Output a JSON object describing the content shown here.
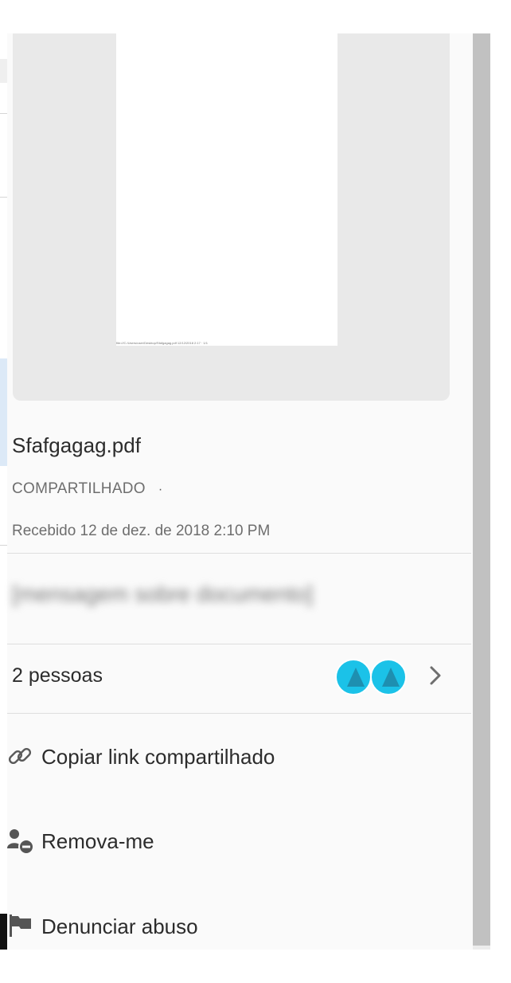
{
  "file": {
    "name": "Sfafgagag.pdf",
    "share_status": "COMPARTILHADO",
    "status_separator": "·",
    "received": "Recebido 12 de dez. de 2018 2:10 PM",
    "preview_footer": "file:///C:/Users/user/Desktop/Sfafgagag.pdf  12/12/2018  2:17 · 1/1"
  },
  "message": {
    "text": "[mensagem sobre documento]"
  },
  "people": {
    "label": "2 pessoas",
    "avatar_color": "#1bc2e8"
  },
  "actions": {
    "copy_link": "Copiar link compartilhado",
    "remove_me": "Remova-me",
    "report_abuse": "Denunciar abuso"
  },
  "icons": {
    "chevron": "chevron-right-icon",
    "copy_link": "link-icon",
    "remove_me": "remove-user-icon",
    "report_abuse": "flag-icon"
  }
}
